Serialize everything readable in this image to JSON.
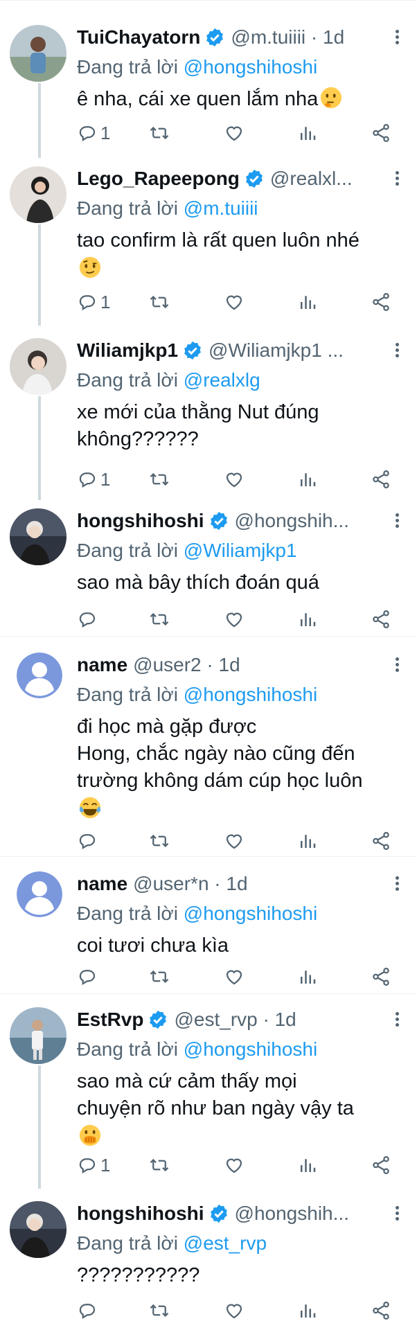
{
  "replying_prefix": "Đang trả lời",
  "replies": [
    {
      "name": "TuiChayatorn",
      "verified": true,
      "handle": "@m.tuiiii · 1d",
      "replying_to": "@hongshihoshi",
      "text": [
        "ê nha, cái xe quen lắm nha"
      ],
      "emoji": "thinking-face",
      "reply_count": "1"
    },
    {
      "name": "Lego_Rapeepong",
      "verified": true,
      "handle": "@realxl...",
      "replying_to": "@m.tuiiii",
      "text": [
        "tao confirm là rất quen luôn nhé"
      ],
      "emoji": "raised-eyebrow-face",
      "reply_count": "1"
    },
    {
      "name": "Wiliamjkp1",
      "verified": true,
      "handle": "@Wiliamjkp1 ...",
      "replying_to": "@realxlg",
      "text": [
        "xe mới của thằng Nut đúng",
        "không??????"
      ],
      "emoji": "",
      "reply_count": "1"
    },
    {
      "name": "hongshihoshi",
      "verified": true,
      "handle": "@hongshih...",
      "replying_to": "@Wiliamjkp1",
      "text": [
        "sao mà bây thích đoán quá"
      ],
      "emoji": "",
      "reply_count": ""
    },
    {
      "name": "name",
      "verified": false,
      "handle": "@user2 · 1d",
      "replying_to": "@hongshihoshi",
      "text": [
        "đi học mà gặp được",
        "Hong, chắc ngày nào cũng đến",
        "trường không dám cúp học luôn"
      ],
      "emoji": "tears-of-joy-face",
      "reply_count": ""
    },
    {
      "name": "name",
      "verified": false,
      "handle": "@user*n · 1d",
      "replying_to": "@hongshihoshi",
      "text": [
        "coi tươi chưa kìa"
      ],
      "emoji": "",
      "reply_count": ""
    },
    {
      "name": "EstRvp",
      "verified": true,
      "handle": "@est_rvp · 1d",
      "replying_to": "@hongshihoshi",
      "text": [
        "sao mà cứ cảm thấy mọi",
        "chuyện rõ như ban ngày vậy ta"
      ],
      "emoji": "hand-over-mouth-face",
      "reply_count": "1"
    },
    {
      "name": "hongshihoshi",
      "verified": true,
      "handle": "@hongshih...",
      "replying_to": "@est_rvp",
      "text": [
        "???????????"
      ],
      "emoji": "",
      "reply_count": ""
    }
  ],
  "colors": {
    "accent": "#1d9bf0",
    "secondary_text": "#536471",
    "text": "#0f1419",
    "divider": "#eff3f4",
    "thread_line": "#cfd9de"
  }
}
